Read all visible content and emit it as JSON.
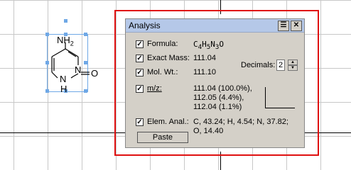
{
  "window": {
    "title": "Analysis"
  },
  "structure": {
    "atoms": {
      "nh2": "NH",
      "nh2_sub": "2",
      "n": "N",
      "nh": "N",
      "h": "H",
      "o": "O"
    }
  },
  "analysis": {
    "formula_label": "Formula:",
    "formula": "C4H5N3O",
    "formula_parts": [
      "C",
      "4",
      "H",
      "5",
      "N",
      "3",
      "O"
    ],
    "exact_mass_label": "Exact Mass:",
    "exact_mass": "111.04",
    "mol_wt_label": "Mol. Wt.:",
    "mol_wt": "111.10",
    "mz_label": "m/z:",
    "mz_lines": [
      "111.04 (100.0%),",
      "112.05 (4.4%),",
      "112.04 (1.1%)"
    ],
    "elem_label": "Elem. Anal.:",
    "elem_lines": [
      "C, 43.24; H, 4.54; N, 37.82;",
      "O, 14.40"
    ],
    "decimals_label": "Decimals:",
    "decimals_value": "2",
    "paste_label": "Paste"
  }
}
